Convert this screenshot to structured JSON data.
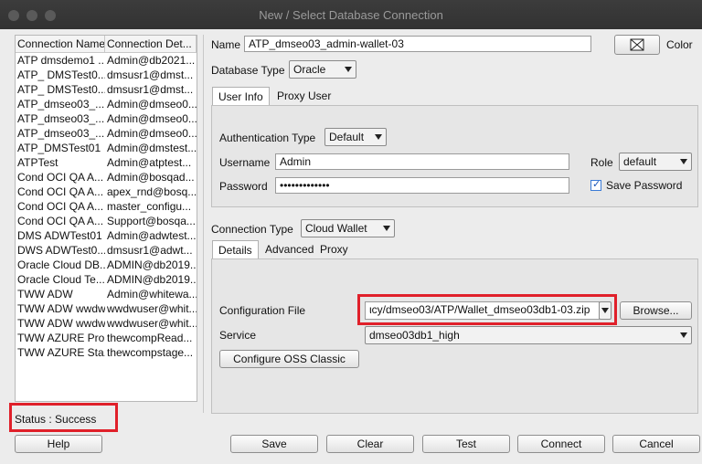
{
  "window": {
    "title": "New / Select Database Connection"
  },
  "list": {
    "headers": [
      "Connection Name",
      "Connection Det..."
    ],
    "rows": [
      [
        "ATP dmsdemo1 ...",
        "Admin@db2021..."
      ],
      [
        "ATP_ DMSTest0...",
        "dmsusr1@dmst..."
      ],
      [
        "ATP_ DMSTest0...",
        "dmsusr1@dmst..."
      ],
      [
        "ATP_dmseo03_...",
        "Admin@dmseo0..."
      ],
      [
        "ATP_dmseo03_...",
        "Admin@dmseo0..."
      ],
      [
        "ATP_dmseo03_...",
        "Admin@dmseo0..."
      ],
      [
        "ATP_DMSTest01",
        "Admin@dmstest..."
      ],
      [
        "ATPTest",
        "Admin@atptest..."
      ],
      [
        "Cond OCI QA A...",
        "Admin@bosqad..."
      ],
      [
        "Cond OCI QA A...",
        "apex_rnd@bosq..."
      ],
      [
        "Cond OCI QA A...",
        "master_configu..."
      ],
      [
        "Cond OCI QA A...",
        "Support@bosqa..."
      ],
      [
        "DMS ADWTest01",
        "Admin@adwtest..."
      ],
      [
        "DWS ADWTest0...",
        "dmsusr1@adwt..."
      ],
      [
        "Oracle Cloud DB...",
        "ADMIN@db2019..."
      ],
      [
        "Oracle Cloud Te...",
        "ADMIN@db2019..."
      ],
      [
        "TWW ADW",
        "Admin@whitewa..."
      ],
      [
        "TWW ADW wwdw...",
        "wwdwuser@whit..."
      ],
      [
        "TWW ADW wwdw...",
        "wwdwuser@whit..."
      ],
      [
        "TWW AZURE Pro...",
        "thewcompRead..."
      ],
      [
        "TWW AZURE Sta...",
        "thewcompstage..."
      ]
    ]
  },
  "form": {
    "name_label": "Name",
    "name_value": "ATP_dmseo03_admin-wallet-03",
    "color_label": "Color",
    "db_type_label": "Database Type",
    "db_type_value": "Oracle",
    "tabs_top": [
      "User Info",
      "Proxy User"
    ],
    "auth_type_label": "Authentication Type",
    "auth_type_value": "Default",
    "username_label": "Username",
    "username_value": "Admin",
    "password_label": "Password",
    "password_value": "•••••••••••••",
    "role_label": "Role",
    "role_value": "default",
    "save_password_label": "Save Password",
    "conn_type_label": "Connection Type",
    "conn_type_value": "Cloud Wallet",
    "tabs_bottom": [
      "Details",
      "Advanced",
      "Proxy"
    ],
    "config_file_label": "Configuration File",
    "config_file_value": "ιcy/dmseo03/ATP/Wallet_dmseo03db1-03.zip",
    "browse_label": "Browse...",
    "service_label": "Service",
    "service_value": "dmseo03db1_high",
    "configure_oss_label": "Configure OSS Classic"
  },
  "status": {
    "text": "Status : Success"
  },
  "buttons": {
    "help": "Help",
    "save": "Save",
    "clear": "Clear",
    "test": "Test",
    "connect": "Connect",
    "cancel": "Cancel"
  },
  "colors": {
    "highlight": "#e0202a",
    "titlebar": "#363636"
  }
}
